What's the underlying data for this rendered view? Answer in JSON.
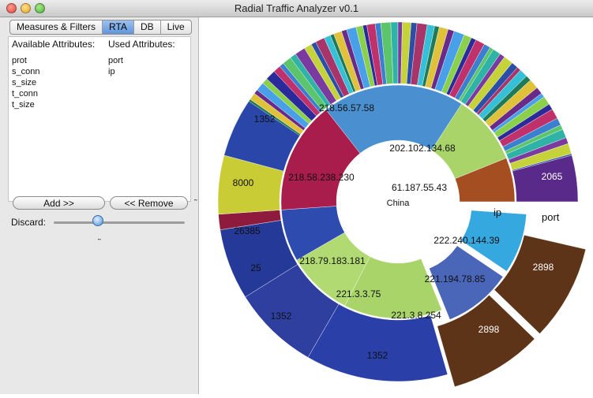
{
  "window": {
    "title": "Radial Traffic Analyzer v0.1"
  },
  "tabs": [
    "Measures & Filters",
    "RTA",
    "DB",
    "Live"
  ],
  "active_tab": "RTA",
  "attributes": {
    "available_header": "Available Attributes:",
    "used_header": "Used Attributes:",
    "available": [
      "prot",
      "s_conn",
      "s_size",
      "t_conn",
      "t_size"
    ],
    "used": [
      "port",
      "ip"
    ]
  },
  "buttons": {
    "add": "Add >>",
    "remove": "<< Remove"
  },
  "discard": {
    "label": "Discard:"
  },
  "chart": {
    "center_label": "China",
    "ring_labels": {
      "ip": "ip",
      "port": "port"
    },
    "ip_labels": [
      "218.56.57.58",
      "202.102.134.68",
      "61.187.55.43",
      "222.240.144.39",
      "221.194.78.85",
      "221.3.8.254",
      "221.3.3.75",
      "218.79.183.181",
      "218.58.238.230"
    ],
    "port_labels": [
      "2065",
      "2898",
      "2898",
      "1352",
      "1352",
      "25",
      "26385",
      "8000",
      "1352"
    ],
    "colors": {
      "blue_ip": "#4a90d0",
      "green_ip": "#a8d46a",
      "rust": "#a44e22",
      "cyan": "#35a8e0",
      "slate": "#4a66b8",
      "crimson": "#a81d4c",
      "navy": "#2b3fa8",
      "brown": "#5e3418",
      "olive": "#c9cc34",
      "purple": "#5a2a8a"
    }
  }
}
